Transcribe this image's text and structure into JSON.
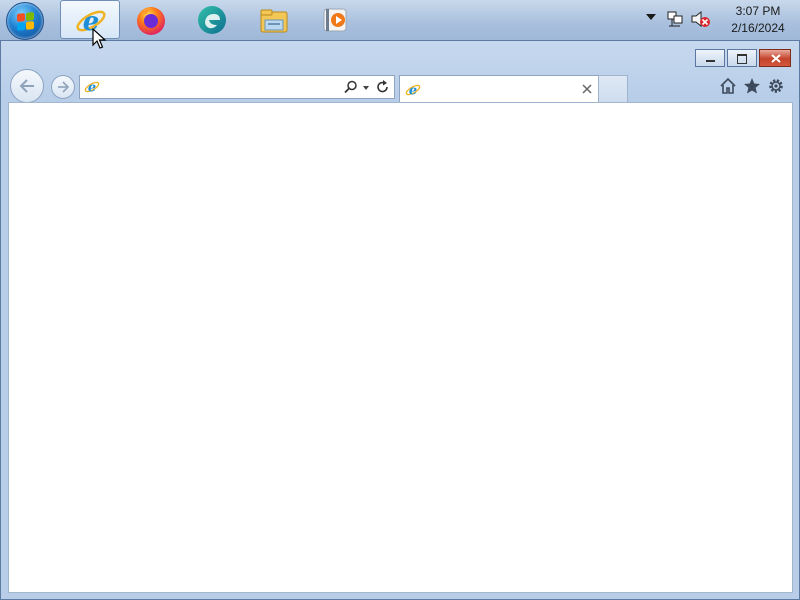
{
  "taskbar": {
    "start_button": "start-orb",
    "pinned": [
      {
        "name": "Internet Explorer",
        "icon": "ie-icon",
        "active": true
      },
      {
        "name": "Firefox",
        "icon": "firefox-icon",
        "active": false
      },
      {
        "name": "Edge",
        "icon": "edge-icon",
        "active": false
      },
      {
        "name": "File Explorer",
        "icon": "folder-icon",
        "active": false
      },
      {
        "name": "Media Player",
        "icon": "media-player-icon",
        "active": false
      }
    ],
    "tray": {
      "show_hidden_icon": "chevron-down-icon",
      "network_icon": "network-icon",
      "volume_icon": "volume-muted-icon"
    },
    "clock": {
      "time": "3:07 PM",
      "date": "2/16/2024"
    }
  },
  "browser": {
    "address": {
      "value": "",
      "placeholder": ""
    },
    "tab": {
      "title": ""
    },
    "caption_buttons": [
      "minimize",
      "maximize",
      "close"
    ],
    "command_icons": [
      "home-icon",
      "favorites-star-icon",
      "tools-gear-icon"
    ]
  },
  "colors": {
    "taskbar": "#aac1de",
    "window_frame": "#b7cde8",
    "close_button": "#c4432c",
    "content": "#ffffff"
  }
}
